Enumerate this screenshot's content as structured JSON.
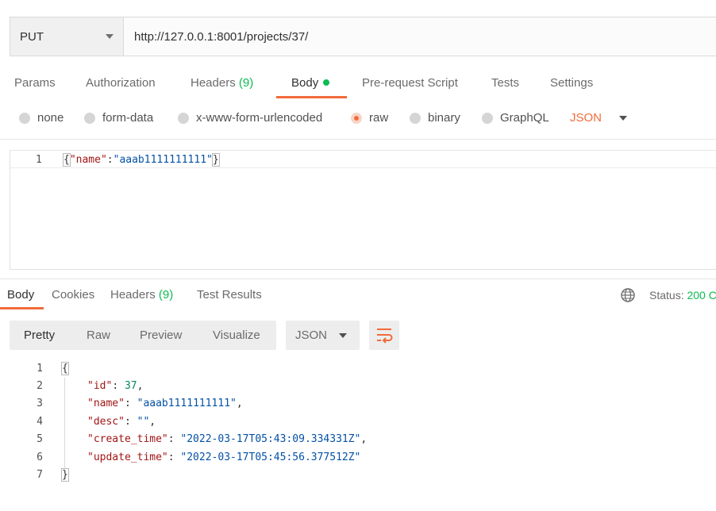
{
  "request": {
    "method": "PUT",
    "url": "http://127.0.0.1:8001/projects/37/"
  },
  "request_tabs": [
    {
      "label": "Params"
    },
    {
      "label": "Authorization"
    },
    {
      "label": "Headers",
      "count": "(9)"
    },
    {
      "label": "Body",
      "active": true,
      "has_dot": true
    },
    {
      "label": "Pre-request Script"
    },
    {
      "label": "Tests"
    },
    {
      "label": "Settings"
    }
  ],
  "body_modes": {
    "options": [
      "none",
      "form-data",
      "x-www-form-urlencoded",
      "raw",
      "binary",
      "GraphQL"
    ],
    "selected": "raw",
    "format": "JSON"
  },
  "request_body": {
    "line_number": "1",
    "open": "{",
    "key": "\"name\"",
    "colon": ":",
    "value": "\"aaab1111111111\"",
    "close": "}"
  },
  "response_tabs": [
    {
      "label": "Body",
      "active": true
    },
    {
      "label": "Cookies"
    },
    {
      "label": "Headers",
      "count": "(9)"
    },
    {
      "label": "Test Results"
    }
  ],
  "status": {
    "label": "Status:",
    "code": "200 C"
  },
  "view_modes": [
    "Pretty",
    "Raw",
    "Preview",
    "Visualize"
  ],
  "view_selected": "Pretty",
  "response_format": "JSON",
  "response_body": {
    "l1": {
      "num": "1",
      "text": "{"
    },
    "l2": {
      "num": "2",
      "key": "\"id\"",
      "sep": ": ",
      "val": "37",
      "end": ","
    },
    "l3": {
      "num": "3",
      "key": "\"name\"",
      "sep": ": ",
      "val": "\"aaab1111111111\"",
      "end": ","
    },
    "l4": {
      "num": "4",
      "key": "\"desc\"",
      "sep": ": ",
      "val": "\"\"",
      "end": ","
    },
    "l5": {
      "num": "5",
      "key": "\"create_time\"",
      "sep": ": ",
      "val": "\"2022-03-17T05:43:09.334331Z\"",
      "end": ","
    },
    "l6": {
      "num": "6",
      "key": "\"update_time\"",
      "sep": ": ",
      "val": "\"2022-03-17T05:45:56.377512Z\"",
      "end": ""
    },
    "l7": {
      "num": "7",
      "text": "}"
    }
  },
  "colors": {
    "accent": "#f26b3a",
    "success": "#0cbb52"
  }
}
